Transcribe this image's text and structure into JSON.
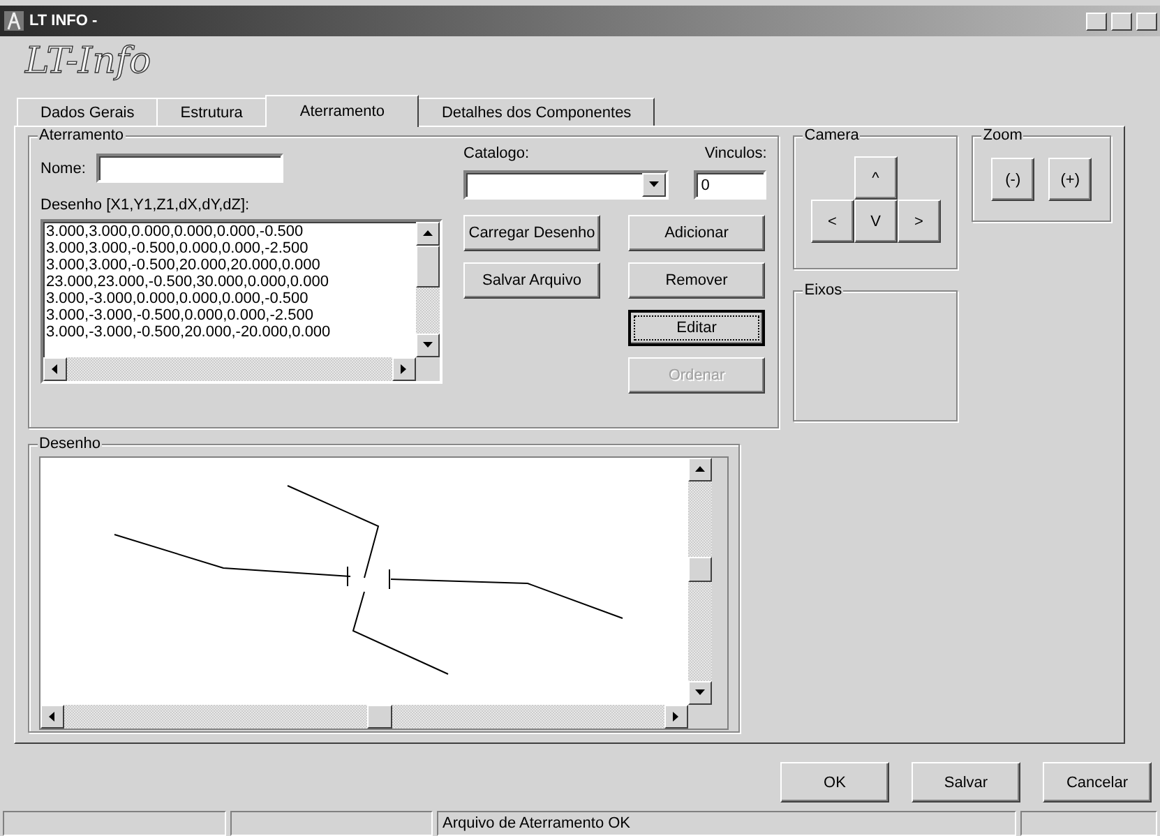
{
  "window": {
    "title": "LT INFO -"
  },
  "logo": "LT-Info",
  "tabs": [
    {
      "label": "Dados Gerais",
      "selected": false
    },
    {
      "label": "Estrutura",
      "selected": false
    },
    {
      "label": "Aterramento",
      "selected": true
    },
    {
      "label": "Detalhes dos Componentes",
      "selected": false
    }
  ],
  "aterramento": {
    "title": "Aterramento",
    "name_label": "Nome:",
    "desenho_label": "Desenho [X1,Y1,Z1,dX,dY,dZ]:",
    "catalog_label": "Catalogo:",
    "vinculos_label": "Vinculos:",
    "vinculos_value": "0",
    "lines": [
      "3.000,3.000,0.000,0.000,0.000,-0.500",
      "3.000,3.000,-0.500,0.000,0.000,-2.500",
      "3.000,3.000,-0.500,20.000,20.000,0.000",
      "23.000,23.000,-0.500,30.000,0.000,0.000",
      "3.000,-3.000,0.000,0.000,0.000,-0.500",
      "3.000,-3.000,-0.500,0.000,0.000,-2.500",
      "3.000,-3.000,-0.500,20.000,-20.000,0.000"
    ],
    "buttons": [
      {
        "label": "Carregar Desenho",
        "disabled": false,
        "focused": false
      },
      {
        "label": "Adicionar",
        "disabled": false,
        "focused": false
      },
      {
        "label": "Salvar Arquivo",
        "disabled": false,
        "focused": false
      },
      {
        "label": "Remover",
        "disabled": false,
        "focused": false
      },
      {
        "label": "Editar",
        "disabled": false,
        "focused": true
      },
      {
        "label": "Ordenar",
        "disabled": true,
        "focused": false
      }
    ]
  },
  "camera": {
    "title": "Camera",
    "buttons": [
      "^",
      "<",
      "V",
      ">"
    ]
  },
  "zoom": {
    "title": "Zoom",
    "buttons": [
      "(-)",
      "(+)"
    ]
  },
  "eixos": {
    "title": "Eixos"
  },
  "desenho": {
    "title": "Desenho"
  },
  "footer_buttons": [
    "OK",
    "Salvar",
    "Cancelar"
  ],
  "status_bar": {
    "message": "Arquivo de Aterramento OK"
  }
}
